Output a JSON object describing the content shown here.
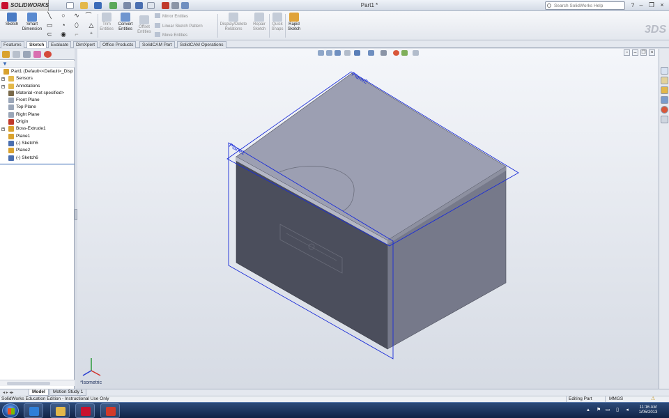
{
  "app": {
    "logo_text": "SOLIDWORKS",
    "window_title": "Part1 *",
    "search_placeholder": "Search SolidWorks Help"
  },
  "ribbon": {
    "sketch": "Sketch",
    "smart_dimension": [
      "Smart",
      "Dimension"
    ],
    "trim_entities": [
      "Trim",
      "Entities"
    ],
    "convert_entities": [
      "Convert",
      "Entities"
    ],
    "offset_entities": [
      "Offset",
      "Entities"
    ],
    "mirror_entities": "Mirror Entities",
    "linear_sketch_pattern": "Linear Sketch Pattern",
    "move_entities": "Move Entities",
    "display_delete_relations": [
      "Display/Delete",
      "Relations"
    ],
    "repair_sketch": [
      "Repair",
      "Sketch"
    ],
    "quick_snaps": [
      "Quick",
      "Snaps"
    ],
    "rapid_sketch": [
      "Rapid",
      "Sketch"
    ]
  },
  "tabs": [
    "Features",
    "Sketch",
    "Evaluate",
    "DimXpert",
    "Office Products",
    "SolidCAM Part",
    "SolidCAM Operations"
  ],
  "active_tab": "Sketch",
  "feature_tree": [
    {
      "label": "Part1  (Default<<Default>_Disp",
      "icon": "part-icon",
      "color": "#d9a22e"
    },
    {
      "label": "Sensors",
      "icon": "sensors-folder-icon",
      "color": "#e3b84a"
    },
    {
      "label": "Annotations",
      "icon": "annotations-icon",
      "color": "#e3b84a"
    },
    {
      "label": "Material <not specified>",
      "icon": "material-icon",
      "color": "#7a6a4a"
    },
    {
      "label": "Front Plane",
      "icon": "plane-icon",
      "color": "#9aa6b8"
    },
    {
      "label": "Top Plane",
      "icon": "plane-icon",
      "color": "#9aa6b8"
    },
    {
      "label": "Right Plane",
      "icon": "plane-icon",
      "color": "#9aa6b8"
    },
    {
      "label": "Origin",
      "icon": "origin-icon",
      "color": "#c0392b"
    },
    {
      "label": "Boss-Extrude1",
      "icon": "extrude-icon",
      "color": "#d9a22e"
    },
    {
      "label": "Plane1",
      "icon": "plane-icon",
      "color": "#d9a22e"
    },
    {
      "label": "(-) Sketch5",
      "icon": "sketch-icon",
      "color": "#4a6fb0"
    },
    {
      "label": "Plane2",
      "icon": "plane-icon",
      "color": "#d9a22e"
    },
    {
      "label": "(-) Sketch6",
      "icon": "sketch-icon",
      "color": "#4a6fb0"
    }
  ],
  "viewport": {
    "plane1_label": "Plane1",
    "plane2_label": "Plane2",
    "view_orientation": "*Isometric"
  },
  "model_tabs": [
    "Model",
    "Motion Study 1"
  ],
  "status": {
    "edition": "SolidWorks Education Edition - Instructional Use Only",
    "mode": "Editing Part",
    "units": "MMGS"
  },
  "taskbar": {
    "time": "11:16 AM",
    "date": "1/05/2013",
    "apps": [
      {
        "name": "internet-explorer-icon",
        "color": "#2f7fd8"
      },
      {
        "name": "file-explorer-icon",
        "color": "#e3b84a"
      },
      {
        "name": "adobe-reader-icon",
        "color": "#c8102e"
      },
      {
        "name": "solidworks-taskbar-icon",
        "color": "#d23a2a"
      }
    ]
  }
}
